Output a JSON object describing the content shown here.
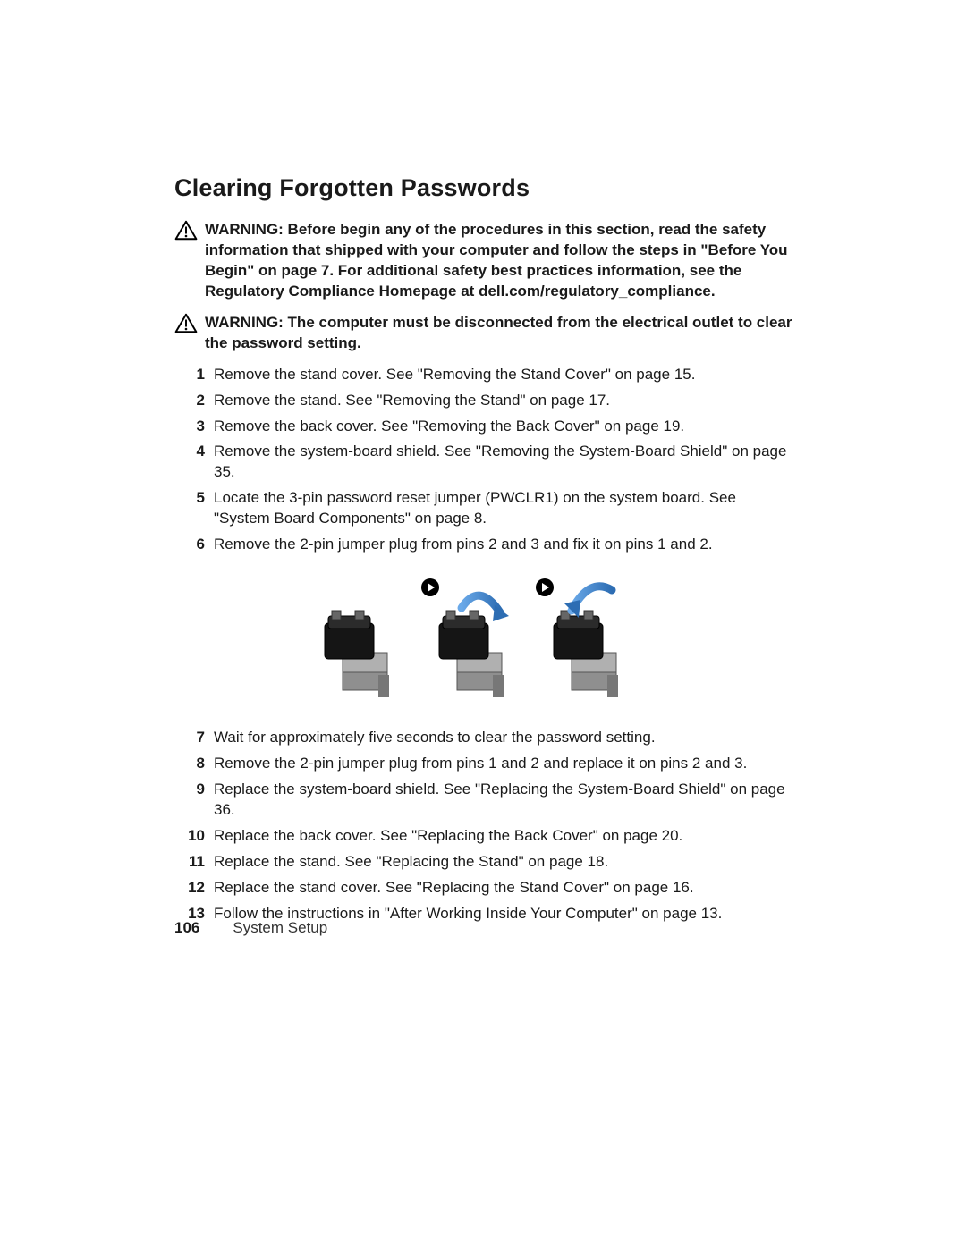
{
  "title": "Clearing Forgotten Passwords",
  "warnings": [
    "WARNING:  Before begin any of the procedures in this section, read the safety information that shipped with your computer and follow the steps in  \"Before You Begin\" on page 7. For additional safety best practices information, see the Regulatory Compliance Homepage at dell.com/regulatory_compliance.",
    "WARNING:  The computer must be disconnected from the electrical outlet to clear the password setting."
  ],
  "steps_a": [
    "Remove the stand cover. See \"Removing the Stand Cover\" on page 15.",
    "Remove the stand. See \"Removing the Stand\" on page 17.",
    "Remove the back cover. See \"Removing the Back Cover\" on page 19.",
    "Remove the system-board shield. See \"Removing the System-Board Shield\" on page 35.",
    "Locate the 3-pin password reset jumper (PWCLR1) on the system board. See \"System Board Components\" on page 8.",
    "Remove the 2-pin jumper plug from pins 2 and 3 and fix it on pins 1 and 2."
  ],
  "steps_b_start": 7,
  "steps_b": [
    "Wait for approximately five seconds to clear the password setting.",
    "Remove the 2-pin jumper plug from pins 1 and 2 and replace it on pins 2 and 3.",
    "Replace the system-board shield. See \"Replacing the System-Board Shield\" on page 36.",
    "Replace the back cover. See \"Replacing the Back Cover\" on page 20.",
    "Replace the stand. See \"Replacing the Stand\" on page 18.",
    "Replace the stand cover. See \"Replacing the Stand Cover\" on page 16.",
    "Follow the instructions in \"After Working Inside Your Computer\" on page 13."
  ],
  "footer": {
    "page_number": "106",
    "section": "System Setup"
  }
}
